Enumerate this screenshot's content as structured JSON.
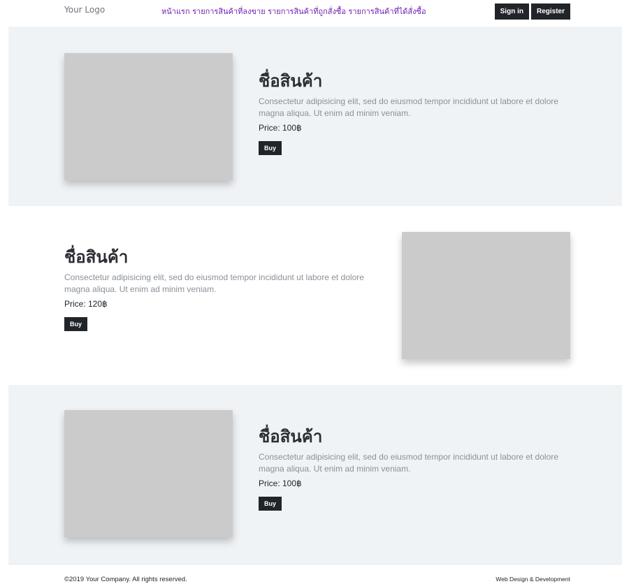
{
  "header": {
    "logo": "Your Logo",
    "nav": [
      "หน้าแรก",
      "รายการสินค้าที่ลงขาย",
      "รายการสินค้าที่ถูกสั่งซื้อ",
      "รายการสินค้าที่ได้สั่งซื้อ"
    ],
    "sign_in": "Sign in",
    "register": "Register"
  },
  "products": [
    {
      "title": "ชื่อสินค้า",
      "description": "Consectetur adipisicing elit, sed do eiusmod tempor incididunt ut labore et dolore magna aliqua. Ut enim ad minim veniam.",
      "price": "Price: 100฿",
      "buy": "Buy"
    },
    {
      "title": "ชื่อสินค้า",
      "description": "Consectetur adipisicing elit, sed do eiusmod tempor incididunt ut labore et dolore magna aliqua. Ut enim ad minim veniam.",
      "price": "Price: 120฿",
      "buy": "Buy"
    },
    {
      "title": "ชื่อสินค้า",
      "description": "Consectetur adipisicing elit, sed do eiusmod tempor incididunt ut labore et dolore magna aliqua. Ut enim ad minim veniam.",
      "price": "Price: 100฿",
      "buy": "Buy"
    }
  ],
  "footer": {
    "copyright": "©2019 Your Company. All rights reserved.",
    "credit": "Web Design & Development"
  },
  "colors": {
    "nav_link": "#6f1fb1",
    "section_bg": "#f0f3f6",
    "button_bg": "#212529",
    "image_placeholder": "#cbcbcb"
  }
}
